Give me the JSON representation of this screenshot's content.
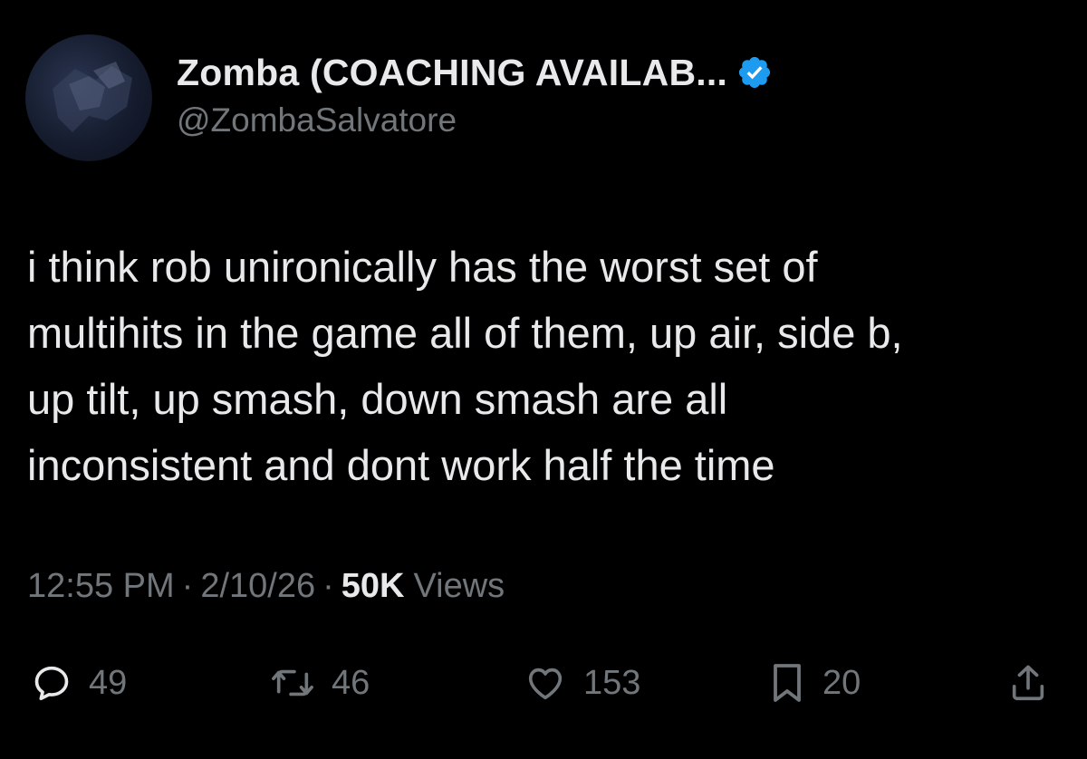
{
  "author": {
    "display_name": "Zomba (COACHING AVAILAB...",
    "handle": "@ZombaSalvatore",
    "verified_icon": "verified-badge-icon",
    "verified_color": "#1d9bf0"
  },
  "tweet": {
    "text": "i think rob unironically has the worst set of\nmultihits in the game all of them, up air, side b,\nup tilt, up smash, down smash are all\ninconsistent and dont work half the time"
  },
  "meta": {
    "time": "12:55 PM",
    "separator": "·",
    "date": "2/10/26",
    "views_count": "50K",
    "views_label": "Views"
  },
  "actions": {
    "reply": {
      "icon": "reply-icon",
      "count": "49"
    },
    "retweet": {
      "icon": "retweet-icon",
      "count": "46"
    },
    "like": {
      "icon": "heart-icon",
      "count": "153"
    },
    "bookmark": {
      "icon": "bookmark-icon",
      "count": "20"
    },
    "share": {
      "icon": "share-icon"
    }
  },
  "colors": {
    "background": "#000000",
    "primary_text": "#e7e9ea",
    "secondary_text": "#71767b",
    "accent": "#1d9bf0"
  }
}
